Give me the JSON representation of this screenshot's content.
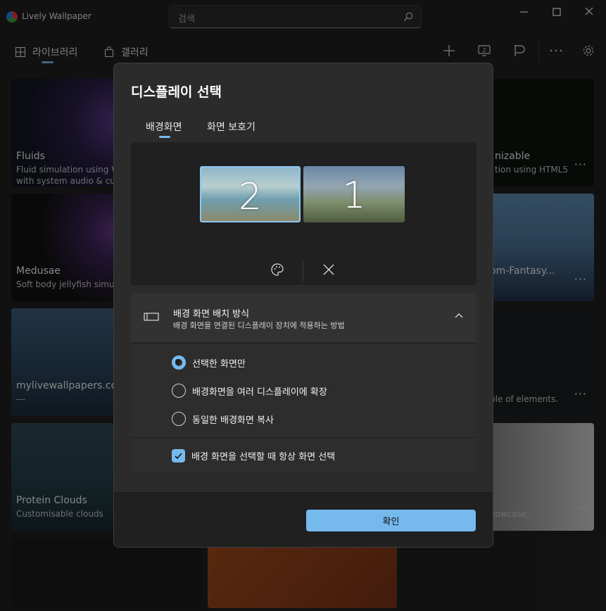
{
  "window": {
    "title": "Lively Wallpaper"
  },
  "search": {
    "placeholder": "검색"
  },
  "nav": {
    "library": "라이브러리",
    "gallery": "갤러리"
  },
  "tiles": [
    {
      "title": "Fluids",
      "desc1": "Fluid simulation using We",
      "desc2": "with system audio & curs"
    },
    {
      "title": "Medusae",
      "desc1": "Soft body jellyfish simulat"
    },
    {
      "title": "mylivewallpapers.com",
      "desc1": "---"
    },
    {
      "title": "Protein Clouds",
      "desc1": "Customisable clouds"
    },
    {
      "title": "nizable",
      "desc1": "tion using HTML5"
    },
    {
      "title": "om-Fantasy..."
    },
    {
      "desc1": "ble of elements."
    },
    {
      "desc1": "howcase."
    }
  ],
  "dialog": {
    "title": "디스플레이 선택",
    "tabs": [
      "배경화면",
      "화면 보호기"
    ],
    "monitors": [
      "2",
      "1"
    ],
    "placement": {
      "title": "배경 화면 배치 방식",
      "subtitle": "배경 화면을 연결된 디스플레이 장치에 적용하는 방법",
      "options": [
        "선택한 화면만",
        "배경화면을 여러 디스플레이에 확장",
        "동일한 배경화면 복사"
      ],
      "selected_index": 0
    },
    "always_select": {
      "label": "배경 화면을 선택할 때 항상 화면 선택",
      "checked": true
    },
    "ok_label": "확인"
  },
  "colors": {
    "accent": "#76b9ed",
    "background": "#202020",
    "dialog": "#2b2b2b"
  }
}
